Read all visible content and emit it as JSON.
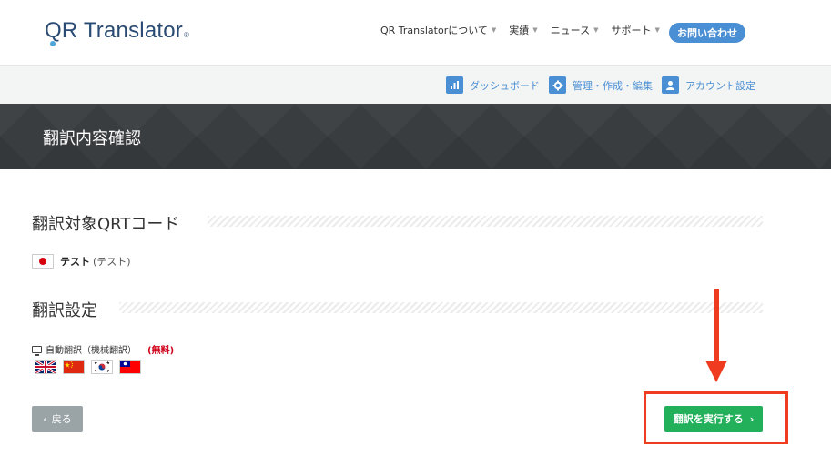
{
  "header": {
    "logo_text": "QR Translator",
    "logo_q": "Q",
    "logo_rest": "R Translator",
    "nav": [
      {
        "label": "QR Translatorについて"
      },
      {
        "label": "実績"
      },
      {
        "label": "ニュース"
      },
      {
        "label": "サポート"
      }
    ],
    "contact_label": "お問い合わせ"
  },
  "subnav": [
    {
      "label": "ダッシュボード",
      "icon": "bar-chart-icon"
    },
    {
      "label": "管理・作成・編集",
      "icon": "gear-icon"
    },
    {
      "label": "アカウント設定",
      "icon": "user-icon"
    }
  ],
  "page": {
    "title": "翻訳内容確認"
  },
  "target_section": {
    "heading": "翻訳対象QRTコード",
    "item_name": "テスト",
    "item_sub": "(テスト)",
    "flag": "jp-flag-icon"
  },
  "settings_section": {
    "heading": "翻訳設定",
    "auto_label": "自動翻訳（機械翻訳）",
    "free_label": "(無料)",
    "flags": [
      "uk-flag-icon",
      "cn-flag-icon",
      "kr-flag-icon",
      "tw-flag-icon"
    ]
  },
  "actions": {
    "back_label": "戻る",
    "execute_label": "翻訳を実行する"
  },
  "colors": {
    "accent_blue": "#4a8fd4",
    "execute_green": "#22b05b",
    "annotation_red": "#ef3b1f",
    "banner_dark": "#3a3d40"
  }
}
